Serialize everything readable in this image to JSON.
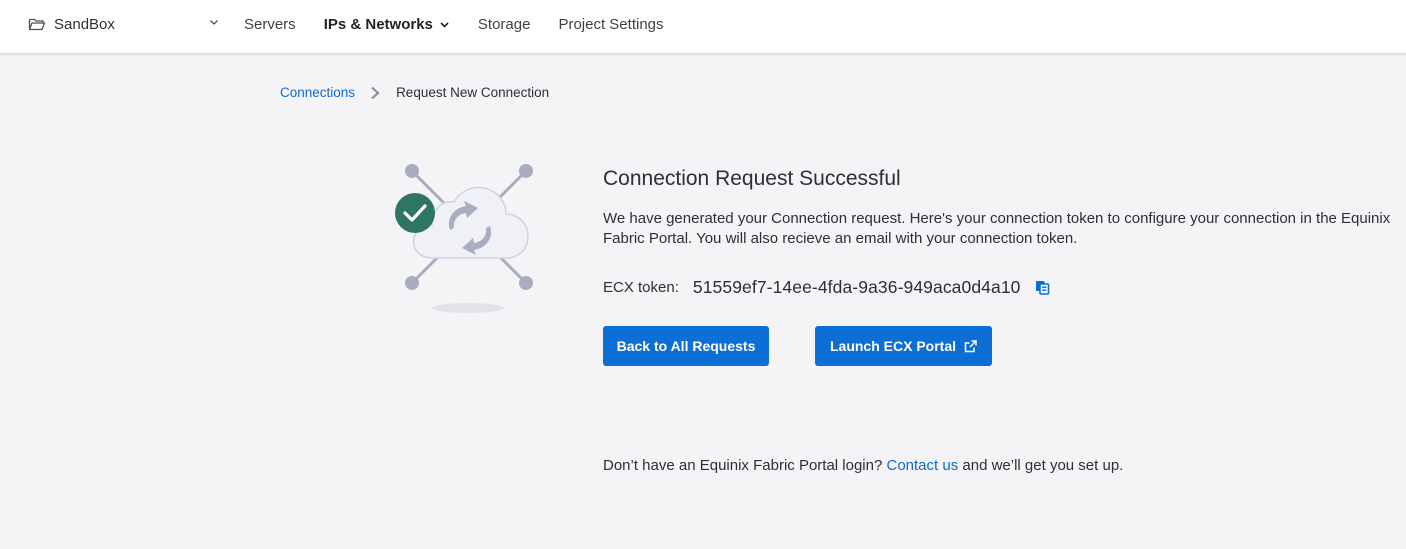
{
  "topbar": {
    "project_name": "SandBox",
    "nav": [
      {
        "label": "Servers"
      },
      {
        "label": "IPs & Networks"
      },
      {
        "label": "Storage"
      },
      {
        "label": "Project Settings"
      }
    ]
  },
  "breadcrumb": {
    "parent": "Connections",
    "current": "Request New Connection"
  },
  "main": {
    "title": "Connection Request Successful",
    "description": "We have generated your Connection request. Here's your connection token to configure your connection in the Equinix Fabric Portal. You will also recieve an email with your connection token.",
    "token_label": "ECX token:",
    "token_value": "51559ef7-14ee-4fda-9a36-949aca0d4a10",
    "back_button": "Back to All Requests",
    "launch_button": "Launch ECX Portal"
  },
  "footer": {
    "prefix": "Don’t have an Equinix Fabric Portal login?",
    "link": "Contact us",
    "suffix": "and we’ll get you set up."
  },
  "colors": {
    "accent": "#0b6fd6",
    "link": "#0b6bcb",
    "success": "#2f7566",
    "background": "#f4f4f7"
  }
}
